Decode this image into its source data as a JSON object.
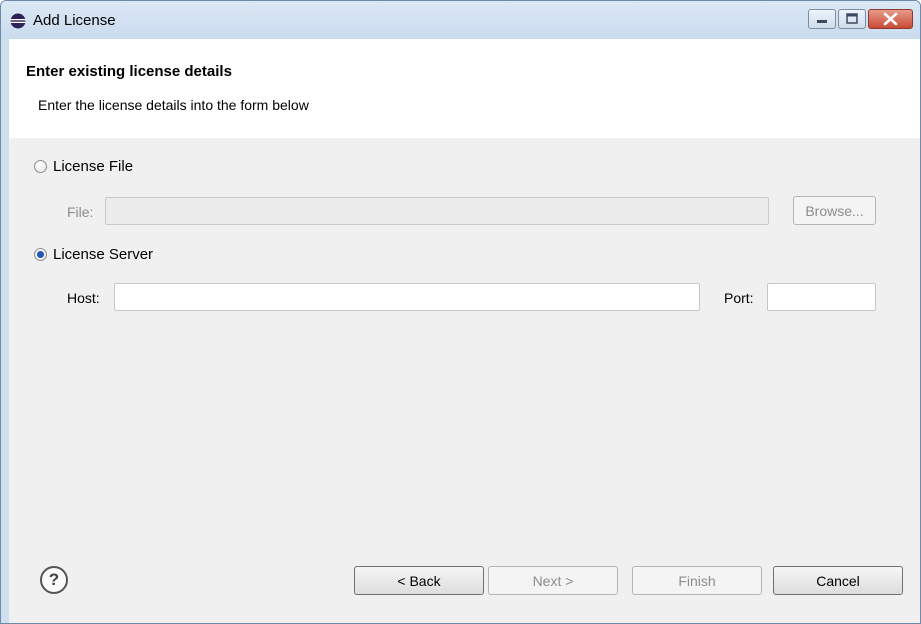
{
  "window": {
    "title": "Add License",
    "icon": "eclipse-app-icon"
  },
  "header": {
    "title": "Enter existing license details",
    "description": "Enter the license details into the form below"
  },
  "license_file": {
    "radio_label": "License File",
    "selected": false,
    "file_label": "File:",
    "file_value": "",
    "browse_label": "Browse..."
  },
  "license_server": {
    "radio_label": "License Server",
    "selected": true,
    "host_label": "Host:",
    "host_value": "",
    "port_label": "Port:",
    "port_value": ""
  },
  "footer": {
    "help_icon": "question-mark-icon",
    "help_glyph": "?",
    "back_label": "< Back",
    "next_label": "Next >",
    "finish_label": "Finish",
    "cancel_label": "Cancel"
  }
}
